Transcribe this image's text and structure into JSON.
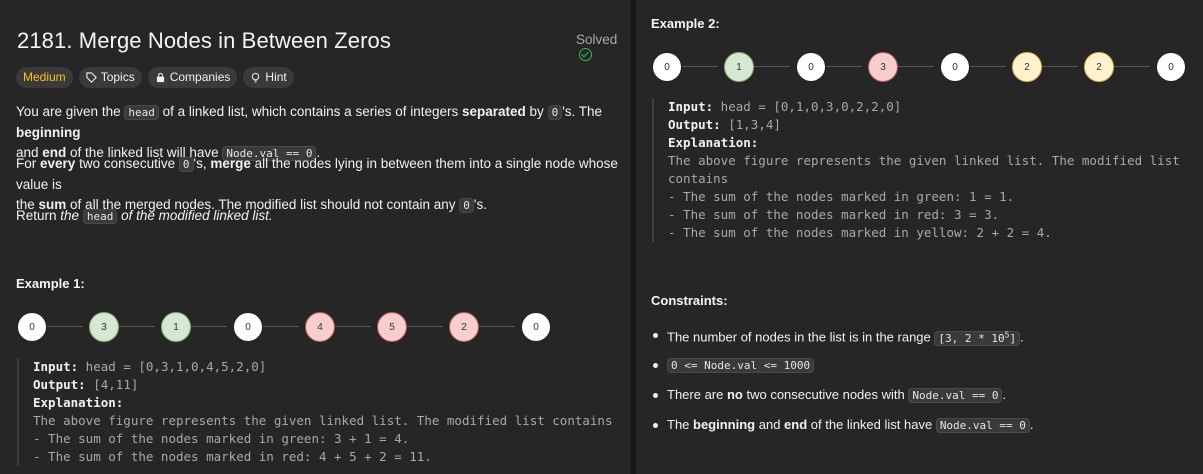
{
  "left": {
    "title": "2181. Merge Nodes in Between Zeros",
    "solved": "Solved",
    "tags": [
      "Medium",
      "Topics",
      "Companies",
      "Hint"
    ],
    "p1": {
      "a": "You are given the ",
      "code_head": "head",
      "b": " of a linked list, which contains a series of integers ",
      "separated": "separated",
      "c": " by ",
      "code_zero": "0",
      "d": "'s. The ",
      "beginning": "beginning",
      "e": "and ",
      "end": "end",
      "f": " of the linked list will have ",
      "code_nodeval": "Node.val == 0",
      "g": "."
    },
    "p2": {
      "a": "For ",
      "every": "every",
      "b": " two consecutive ",
      "code_zero": "0",
      "c": "'s, ",
      "merge": "merge",
      "d": " all the nodes lying in between them into a single node whose value is",
      "e": "the ",
      "sum": "sum",
      "f": " of all the merged nodes. The modified list should not contain any ",
      "code_zero2": "0",
      "g": "'s."
    },
    "p3": {
      "a": "Return ",
      "the": "the",
      "code_head": "head",
      "b": "of the modified linked list."
    },
    "example1": {
      "label": "Example 1:",
      "nodes": [
        {
          "v": "0",
          "c": "white"
        },
        {
          "v": "3",
          "c": "green"
        },
        {
          "v": "1",
          "c": "green"
        },
        {
          "v": "0",
          "c": "white"
        },
        {
          "v": "4",
          "c": "red"
        },
        {
          "v": "5",
          "c": "red"
        },
        {
          "v": "2",
          "c": "red"
        },
        {
          "v": "0",
          "c": "white"
        }
      ],
      "input_label": "Input:",
      "input": " head = [0,3,1,0,4,5,2,0]",
      "output_label": "Output:",
      "output": " [4,11]",
      "expl_label": "Explanation:",
      "expl": [
        "The above figure represents the given linked list. The modified list contains",
        "- The sum of the nodes marked in green: 3 + 1 = 4.",
        "- The sum of the nodes marked in red: 4 + 5 + 2 = 11."
      ]
    }
  },
  "right": {
    "example2": {
      "label": "Example 2:",
      "nodes": [
        {
          "v": "0",
          "c": "white"
        },
        {
          "v": "1",
          "c": "green"
        },
        {
          "v": "0",
          "c": "white"
        },
        {
          "v": "3",
          "c": "red"
        },
        {
          "v": "0",
          "c": "white"
        },
        {
          "v": "2",
          "c": "yellow"
        },
        {
          "v": "2",
          "c": "yellow"
        },
        {
          "v": "0",
          "c": "white"
        }
      ],
      "input_label": "Input:",
      "input": " head = [0,1,0,3,0,2,2,0]",
      "output_label": "Output:",
      "output": " [1,3,4]",
      "expl_label": "Explanation:",
      "expl": [
        "The above figure represents the given linked list. The modified list",
        "contains",
        "- The sum of the nodes marked in green: 1 = 1.",
        "- The sum of the nodes marked in red: 3 = 3.",
        "- The sum of the nodes marked in yellow: 2 + 2 = 4."
      ]
    },
    "constraints_label": "Constraints:",
    "c1": {
      "a": "The number of nodes in the list is in the range ",
      "code_a": "[3, 2 * 10",
      "sup": "5",
      "code_b": "]",
      "b": "."
    },
    "c2": {
      "code": "0 <= Node.val <= 1000"
    },
    "c3": {
      "a": "There are ",
      "no": "no",
      "b": " two consecutive nodes with ",
      "code": "Node.val == 0",
      "c": "."
    },
    "c4": {
      "a": "The ",
      "beginning": "beginning",
      "b": " and ",
      "end": "end",
      "c": " of the linked list have ",
      "code": "Node.val == 0",
      "d": "."
    }
  }
}
